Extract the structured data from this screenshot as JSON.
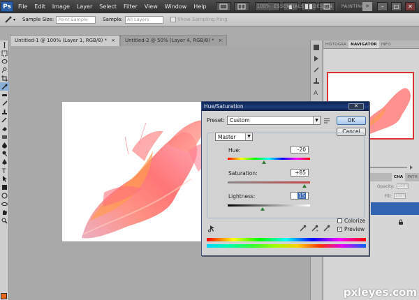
{
  "app": {
    "logo": "Ps"
  },
  "menubar": {
    "items": [
      "File",
      "Edit",
      "Image",
      "Layer",
      "Select",
      "Filter",
      "View",
      "Window",
      "Help"
    ],
    "zoom": "100%",
    "workspaces": [
      "ESSENTIALS",
      "DESIGN",
      "PAINTING"
    ],
    "more": "»",
    "window_controls": [
      "–",
      "□",
      "✕"
    ]
  },
  "options": {
    "sample_size_label": "Sample Size:",
    "sample_size_value": "Point Sample",
    "sample_label": "Sample:",
    "sample_value": "All Layers",
    "show_ring_label": "Show Sampling Ring"
  },
  "tabs": [
    {
      "label": "Untitled-1 @ 100% (Layer 1, RGB/8) *",
      "active": true,
      "close": "×"
    },
    {
      "label": "Untitled-2 @ 50% (Layer 4, RGB/8) *",
      "active": false,
      "close": "×"
    }
  ],
  "panels": {
    "top_tabs": [
      "HISTOGRA",
      "NAVIGATOR",
      "INFO"
    ],
    "layers_tabs": [
      "CHA",
      "PATH"
    ],
    "opacity_label": "Opacity:",
    "opacity_value": "100%",
    "fill_label": "Fill:",
    "fill_value": "100%"
  },
  "dialog": {
    "title": "Hue/Saturation",
    "preset_label": "Preset:",
    "preset_value": "Custom",
    "channel_value": "Master",
    "ok_label": "OK",
    "cancel_label": "Cancel",
    "hue_label": "Hue:",
    "hue_value": "-20",
    "saturation_label": "Saturation:",
    "saturation_value": "+85",
    "lightness_label": "Lightness:",
    "lightness_value": "15",
    "colorize_label": "Colorize",
    "preview_label": "Preview",
    "preview_checked": "✓"
  },
  "slider_positions": {
    "hue": 0.44,
    "saturation": 0.93,
    "lightness": 0.42
  },
  "colors": {
    "accent": "#3063b1",
    "title_bar": "#1e3b78",
    "foreground_swatch": "#e8671a",
    "navigator_frame": "#dd3333"
  },
  "watermark": "pxleyes.com"
}
